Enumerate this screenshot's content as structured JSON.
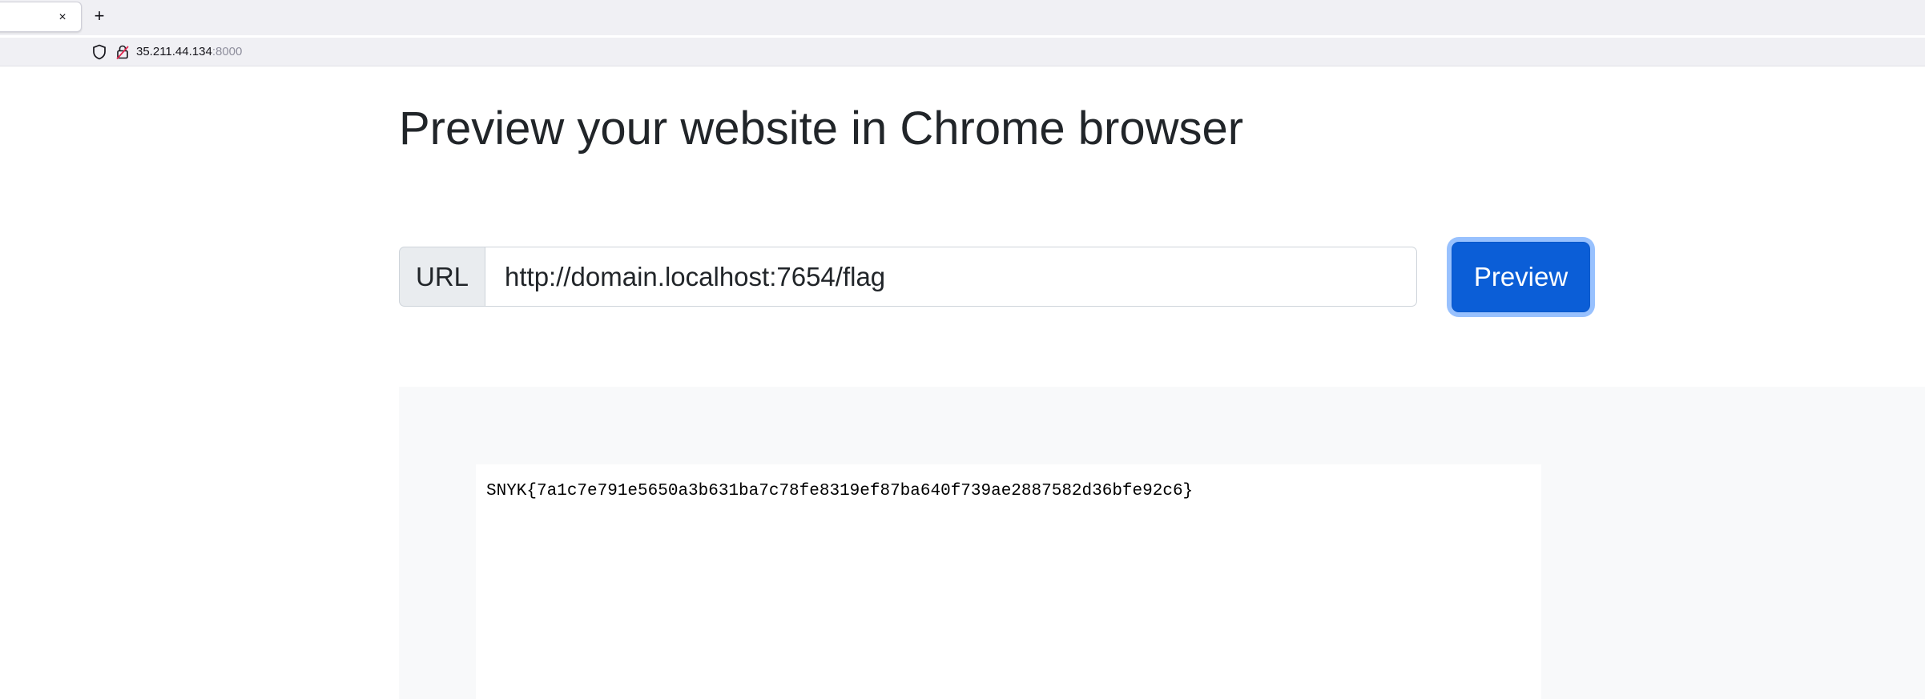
{
  "browser": {
    "tab_close_glyph": "×",
    "new_tab_glyph": "+",
    "address": {
      "host": "35.211.44.134",
      "port": ":8000"
    }
  },
  "page": {
    "title": "Preview your website in Chrome browser",
    "url_label": "URL",
    "url_value": "http://domain.localhost:7654/flag",
    "preview_button": "Preview",
    "preview_output": "SNYK{7a1c7e791e5650a3b631ba7c78fe8319ef87ba640f739ae2887582d36bfe92c6}"
  },
  "colors": {
    "primary": "#0b5ed7",
    "preview_bg": "#f8f9fa"
  },
  "icons": [
    "shield-icon",
    "lock-icon",
    "close-icon",
    "plus-icon"
  ]
}
